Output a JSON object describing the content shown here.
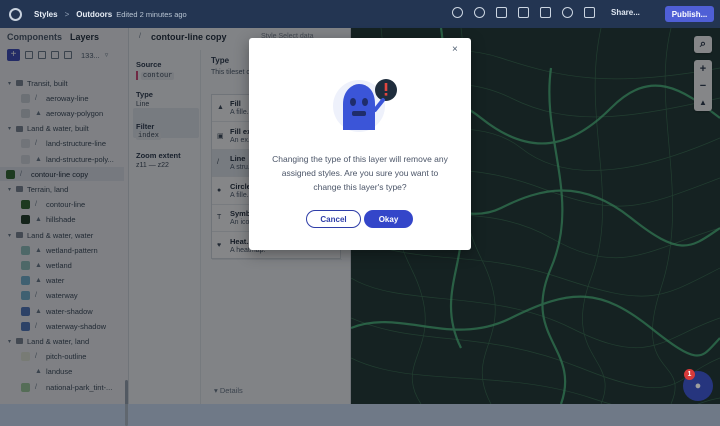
{
  "topbar": {
    "crumb_styles": "Styles",
    "crumb_sep": ">",
    "crumb_outdoors": "Outdoors",
    "edited": "Edited 2 minutes ago",
    "share_label": "Share...",
    "publish_label": "Publish...",
    "icons": [
      "help-icon",
      "bug-icon",
      "text-icon",
      "layout-icon",
      "preview-icon",
      "settings-icon",
      "export-icon"
    ]
  },
  "left": {
    "tab_components": "Components",
    "tab_layers": "Layers",
    "count": "133...",
    "layers": [
      {
        "kind": "group",
        "label": "Transit, built"
      },
      {
        "kind": "item",
        "label": "aeroway-line",
        "color": "#cdd3db",
        "glyph": "/"
      },
      {
        "kind": "item",
        "label": "aeroway-polygon",
        "color": "#cdd3db",
        "glyph": "▲"
      },
      {
        "kind": "group",
        "label": "Land & water, built"
      },
      {
        "kind": "item",
        "label": "land-structure-line",
        "color": "#d7dbe1",
        "glyph": "/"
      },
      {
        "kind": "item",
        "label": "land-structure-poly...",
        "color": "#d7dbe1",
        "glyph": "▲"
      },
      {
        "kind": "selected",
        "label": "contour-line copy",
        "color": "#2d6a2d",
        "glyph": "/"
      },
      {
        "kind": "group",
        "label": "Terrain, land"
      },
      {
        "kind": "item",
        "label": "contour-line",
        "color": "#2d6a2d",
        "glyph": "/"
      },
      {
        "kind": "item",
        "label": "hillshade",
        "color": "#1e3d26",
        "glyph": "▲"
      },
      {
        "kind": "group",
        "label": "Land & water, water"
      },
      {
        "kind": "item",
        "label": "wetland-pattern",
        "color": "#8fc4c0",
        "glyph": "▲"
      },
      {
        "kind": "item",
        "label": "wetland",
        "color": "#8fc4c0",
        "glyph": "▲"
      },
      {
        "kind": "item",
        "label": "water",
        "color": "#6fb6d6",
        "glyph": "▲"
      },
      {
        "kind": "item",
        "label": "waterway",
        "color": "#6fb6d6",
        "glyph": "/"
      },
      {
        "kind": "item",
        "label": "water-shadow",
        "color": "#4f79c7",
        "glyph": "▲"
      },
      {
        "kind": "item",
        "label": "waterway-shadow",
        "color": "#4f79c7",
        "glyph": "/"
      },
      {
        "kind": "group",
        "label": "Land & water, land"
      },
      {
        "kind": "item",
        "label": "pitch-outline",
        "color": "#e4ead8",
        "glyph": "/"
      },
      {
        "kind": "item",
        "label": "landuse",
        "color": "#f1f4f8",
        "glyph": "▲"
      },
      {
        "kind": "item",
        "label": "national-park_tint-...",
        "color": "#9ccf9a",
        "glyph": "/"
      }
    ]
  },
  "mid": {
    "title": "contour-line copy",
    "right_header": "Style   Select data",
    "source_label": "Source",
    "source_value": "contour",
    "type_label": "Type",
    "type_value": "Line",
    "filter_label": "Filter",
    "filter_value": "index",
    "zoom_label": "Zoom extent",
    "zoom_value": "z11  —  z22",
    "types_title": "Type",
    "types_desc": "This tileset contains line features.",
    "types": [
      {
        "name": "Fill",
        "desc": "A fille... optio...",
        "glyph": "▲"
      },
      {
        "name": "Fill ex...",
        "desc": "An ex...",
        "glyph": "▣"
      },
      {
        "name": "Line",
        "desc": "A stru...",
        "glyph": "/"
      },
      {
        "name": "Circle",
        "desc": "A fille...",
        "glyph": "●"
      },
      {
        "name": "Symb...",
        "desc": "An ico...",
        "glyph": "T"
      },
      {
        "name": "Heat...",
        "desc": "A heatmap.",
        "glyph": "♥"
      }
    ],
    "details_label": "▾ Details"
  },
  "map": {
    "search_glyph": "⌕",
    "zoom_in": "+",
    "zoom_out": "−",
    "compass": "▲"
  },
  "modal": {
    "close_glyph": "×",
    "message": "Changing the type of this layer will remove any assigned styles. Are you sure you want to change this layer's type?",
    "cancel_label": "Cancel",
    "okay_label": "Okay"
  },
  "help": {
    "badge": "1"
  },
  "colors": {
    "accent": "#3446c9",
    "topbar": "#233552",
    "map_bg": "#1f3a36",
    "contour": "#3fc27f"
  }
}
